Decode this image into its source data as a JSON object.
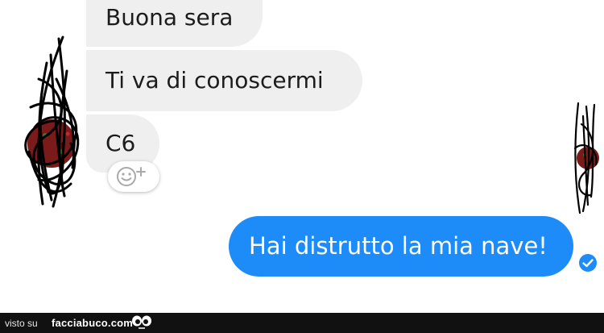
{
  "messages": {
    "received": [
      {
        "text": "Buona sera"
      },
      {
        "text": "Ti va di conoscermi"
      },
      {
        "text": "C6"
      }
    ],
    "sent": [
      {
        "text": "Hai distrutto la mia nave!"
      }
    ]
  },
  "icons": {
    "add_reaction": "smiley-plus-icon",
    "seen_status": "checkmark-circle-icon",
    "footer_logo": "eyes-icon"
  },
  "colors": {
    "sent_bubble": "#1d8cf8",
    "received_bubble": "#efefef",
    "footer_bar": "#111111",
    "scribble": "#000000"
  },
  "footer": {
    "prefix": "visto su",
    "brand": "facciabuco.com"
  }
}
